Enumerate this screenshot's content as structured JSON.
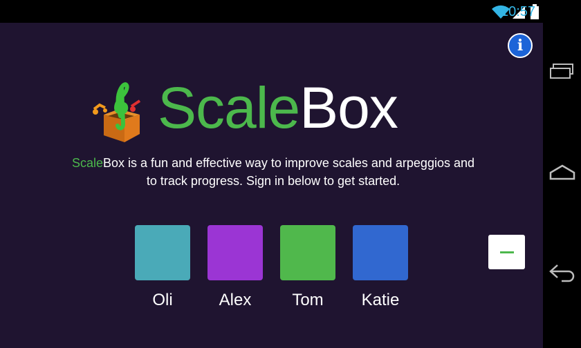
{
  "status_bar": {
    "time": "10:57",
    "icons": [
      "wifi-icon",
      "signal-icon",
      "battery-icon"
    ],
    "time_color": "#33b5e5"
  },
  "app": {
    "background": "#1f1430",
    "logo": {
      "title_part1": "Scale",
      "title_part2": "Box",
      "accent_color": "#4cb84c",
      "icon": "music-box-icon"
    },
    "description": {
      "highlight": "Scale",
      "text": "Box is a fun and effective way to improve scales and arpeggios and to track progress. Sign in below to get started."
    },
    "info_button": {
      "icon": "info-icon",
      "glyph": "i"
    },
    "users": [
      {
        "name": "Oli",
        "color": "#4aaab8"
      },
      {
        "name": "Alex",
        "color": "#9b35d4"
      },
      {
        "name": "Tom",
        "color": "#50b84c"
      },
      {
        "name": "Katie",
        "color": "#3168d0"
      }
    ],
    "remove_button": {
      "icon": "minus-icon"
    }
  },
  "nav_bar": {
    "buttons": [
      "recent-apps-icon",
      "home-icon",
      "back-icon"
    ]
  }
}
